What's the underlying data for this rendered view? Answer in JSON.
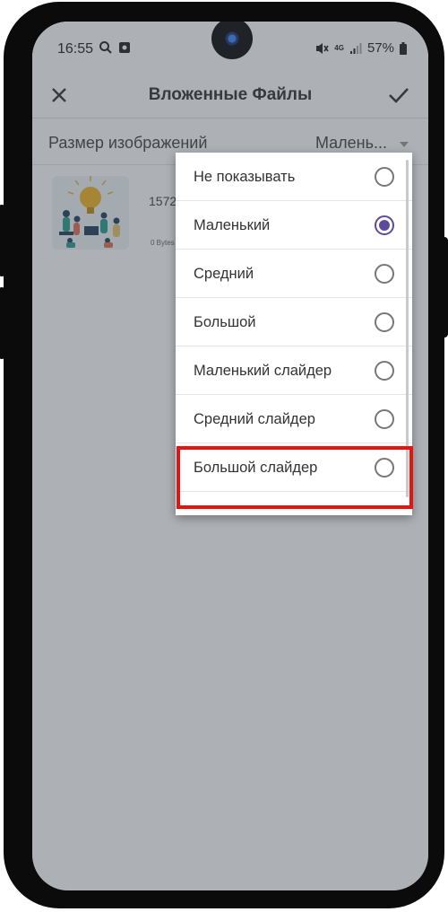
{
  "status_bar": {
    "time": "16:55",
    "network": "4G",
    "battery": "57%"
  },
  "app_bar": {
    "title": "Вложенные Файлы",
    "close_icon": "close-icon",
    "confirm_icon": "check-icon"
  },
  "setting": {
    "label": "Размер изображений",
    "value": "Малень..."
  },
  "attachment": {
    "name": "1572",
    "size": "0 Bytes"
  },
  "menu": {
    "items": [
      {
        "label": "Не показывать",
        "selected": false
      },
      {
        "label": "Маленький",
        "selected": true
      },
      {
        "label": "Средний",
        "selected": false
      },
      {
        "label": "Большой",
        "selected": false
      },
      {
        "label": "Маленький слайдер",
        "selected": false
      },
      {
        "label": "Средний слайдер",
        "selected": false
      },
      {
        "label": "Большой слайдер",
        "selected": false
      }
    ]
  },
  "colors": {
    "accent": "#5c4b9b",
    "highlight": "#e8130f"
  }
}
